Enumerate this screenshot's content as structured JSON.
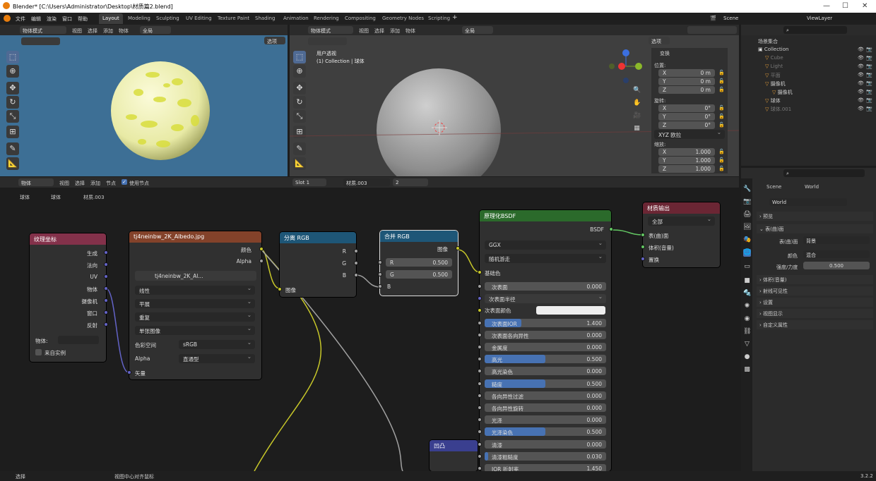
{
  "window": {
    "title": "Blender* [C:\\Users\\Administrator\\Desktop\\材质篇2.blend]"
  },
  "menu": [
    "文件",
    "编辑",
    "渲染",
    "窗口",
    "帮助"
  ],
  "workspaces": [
    "Layout",
    "Modeling",
    "Sculpting",
    "UV Editing",
    "Texture Paint",
    "Shading",
    "Animation",
    "Rendering",
    "Compositing",
    "Geometry Nodes",
    "Scripting"
  ],
  "scene": {
    "name": "Scene",
    "viewlayer": "ViewLayer"
  },
  "left_viewport": {
    "mode": "物体模式",
    "menus": [
      "视图",
      "选择",
      "添加",
      "物体"
    ],
    "orientation": "全局",
    "options": "选项"
  },
  "main_viewport": {
    "mode": "物体模式",
    "menus": [
      "视图",
      "选择",
      "添加",
      "物体"
    ],
    "orientation": "全局",
    "overlay_title": "用户透视",
    "overlay_sub": "(1) Collection | 球体",
    "options": "选项"
  },
  "transform_panel": {
    "title": "变换",
    "location_label": "位置:",
    "location": [
      {
        "axis": "X",
        "value": "0 m"
      },
      {
        "axis": "Y",
        "value": "0 m"
      },
      {
        "axis": "Z",
        "value": "0 m"
      }
    ],
    "rotation_label": "旋转:",
    "rotation": [
      {
        "axis": "X",
        "value": "0°"
      },
      {
        "axis": "Y",
        "value": "0°"
      },
      {
        "axis": "Z",
        "value": "0°"
      }
    ],
    "rotation_mode": "XYZ 欧拉",
    "scale_label": "缩放:",
    "scale": [
      {
        "axis": "X",
        "value": "1.000"
      },
      {
        "axis": "Y",
        "value": "1.000"
      },
      {
        "axis": "Z",
        "value": "1.000"
      }
    ]
  },
  "outliner": {
    "root": "场景集合",
    "items": [
      {
        "name": "Collection",
        "indent": 0
      },
      {
        "name": "Cube",
        "indent": 1
      },
      {
        "name": "Light",
        "indent": 1
      },
      {
        "name": "平面",
        "indent": 1
      },
      {
        "name": "摄像机",
        "indent": 1
      },
      {
        "name": "摄像机",
        "indent": 2
      },
      {
        "name": "球体",
        "indent": 1
      },
      {
        "name": "球体.001",
        "indent": 1
      }
    ]
  },
  "node_editor": {
    "header": {
      "mode": "物体",
      "menus": [
        "视图",
        "选择",
        "添加",
        "节点"
      ],
      "use_nodes": "使用节点",
      "slot": "Slot 1",
      "material": "材质.003",
      "users": "2"
    },
    "breadcrumb": [
      "球体",
      "球体",
      "材质.003"
    ],
    "nodes": {
      "texcoord": {
        "title": "纹理坐标",
        "outputs": [
          "生成",
          "法向",
          "UV",
          "物体",
          "摄像机",
          "窗口",
          "反射"
        ],
        "object_label": "物体:",
        "from_instancer": "来自实例"
      },
      "image": {
        "title": "tj4neinbw_2K_Albedo.jpg",
        "outputs": [
          "颜色",
          "Alpha"
        ],
        "image_name": "tj4neinbw_2K_Al...",
        "interp": "线性",
        "proj": "平展",
        "ext": "重复",
        "source": "单张图像",
        "colorspace_label": "色彩空间",
        "colorspace": "sRGB",
        "alpha_label": "Alpha",
        "alpha": "直通型",
        "input": "矢量"
      },
      "separate": {
        "title": "分离 RGB",
        "outputs": [
          "R",
          "G",
          "B"
        ],
        "input": "图像"
      },
      "combine": {
        "title": "合并 RGB",
        "output": "图像",
        "r_label": "R",
        "r": "0.500",
        "g_label": "G",
        "g": "0.500",
        "b_label": "B"
      },
      "bsdf": {
        "title": "原理化BSDF",
        "output": "BSDF",
        "dist": "GGX",
        "sss": "随机游走",
        "base_color": "基础色",
        "rows": [
          {
            "label": "次表面",
            "value": "0.000",
            "fill": 0
          },
          {
            "label": "次表面半径",
            "value": "",
            "fill": 0,
            "dropdown": true
          },
          {
            "label": "次表面颜色",
            "value": "",
            "fill": 0,
            "color": true
          },
          {
            "label": "次表面IOR",
            "value": "1.400",
            "fill": 0.3
          },
          {
            "label": "次表面各向异性",
            "value": "0.000",
            "fill": 0
          },
          {
            "label": "金属度",
            "value": "0.000",
            "fill": 0
          },
          {
            "label": "高光",
            "value": "0.500",
            "fill": 0.5
          },
          {
            "label": "高光染色",
            "value": "0.000",
            "fill": 0
          },
          {
            "label": "糙度",
            "value": "0.500",
            "fill": 0.5
          },
          {
            "label": "各向异性过滤",
            "value": "0.000",
            "fill": 0
          },
          {
            "label": "各向异性旋转",
            "value": "0.000",
            "fill": 0
          },
          {
            "label": "光泽",
            "value": "0.000",
            "fill": 0
          },
          {
            "label": "光泽染色",
            "value": "0.500",
            "fill": 0.5
          },
          {
            "label": "清漆",
            "value": "0.000",
            "fill": 0
          },
          {
            "label": "清漆粗糙度",
            "value": "0.030",
            "fill": 0.03
          },
          {
            "label": "IOR 折射率",
            "value": "1.450",
            "fill": 0
          }
        ]
      },
      "output": {
        "title": "材质输出",
        "target": "全部",
        "inputs": [
          "表(曲)面",
          "体积(音量)",
          "置换"
        ]
      },
      "bump": {
        "title": "凹凸"
      }
    }
  },
  "properties": {
    "breadcrumb": [
      "Scene",
      "World"
    ],
    "world_name": "World",
    "sections": [
      "预览",
      "表(曲)面",
      "体积(音量)",
      "射线可见性",
      "设置",
      "视图显示",
      "自定义属性"
    ],
    "surface_label": "表(曲)面",
    "surface_value": "背景",
    "color_label": "颜色",
    "color_value": "混合",
    "strength_label": "强度/力度",
    "strength_value": "0.500"
  },
  "status": {
    "left": "选择",
    "mid": "视图中心对齐鼠标",
    "version": "3.2.2"
  },
  "colors": {
    "accent": "#4772b3",
    "texcoord_header": "#83314a",
    "image_header": "#83422a",
    "converter_header": "#1e5677",
    "shader_header": "#2b6a2b",
    "output_header": "#6b2634",
    "vector_header": "#3a3f8f"
  }
}
